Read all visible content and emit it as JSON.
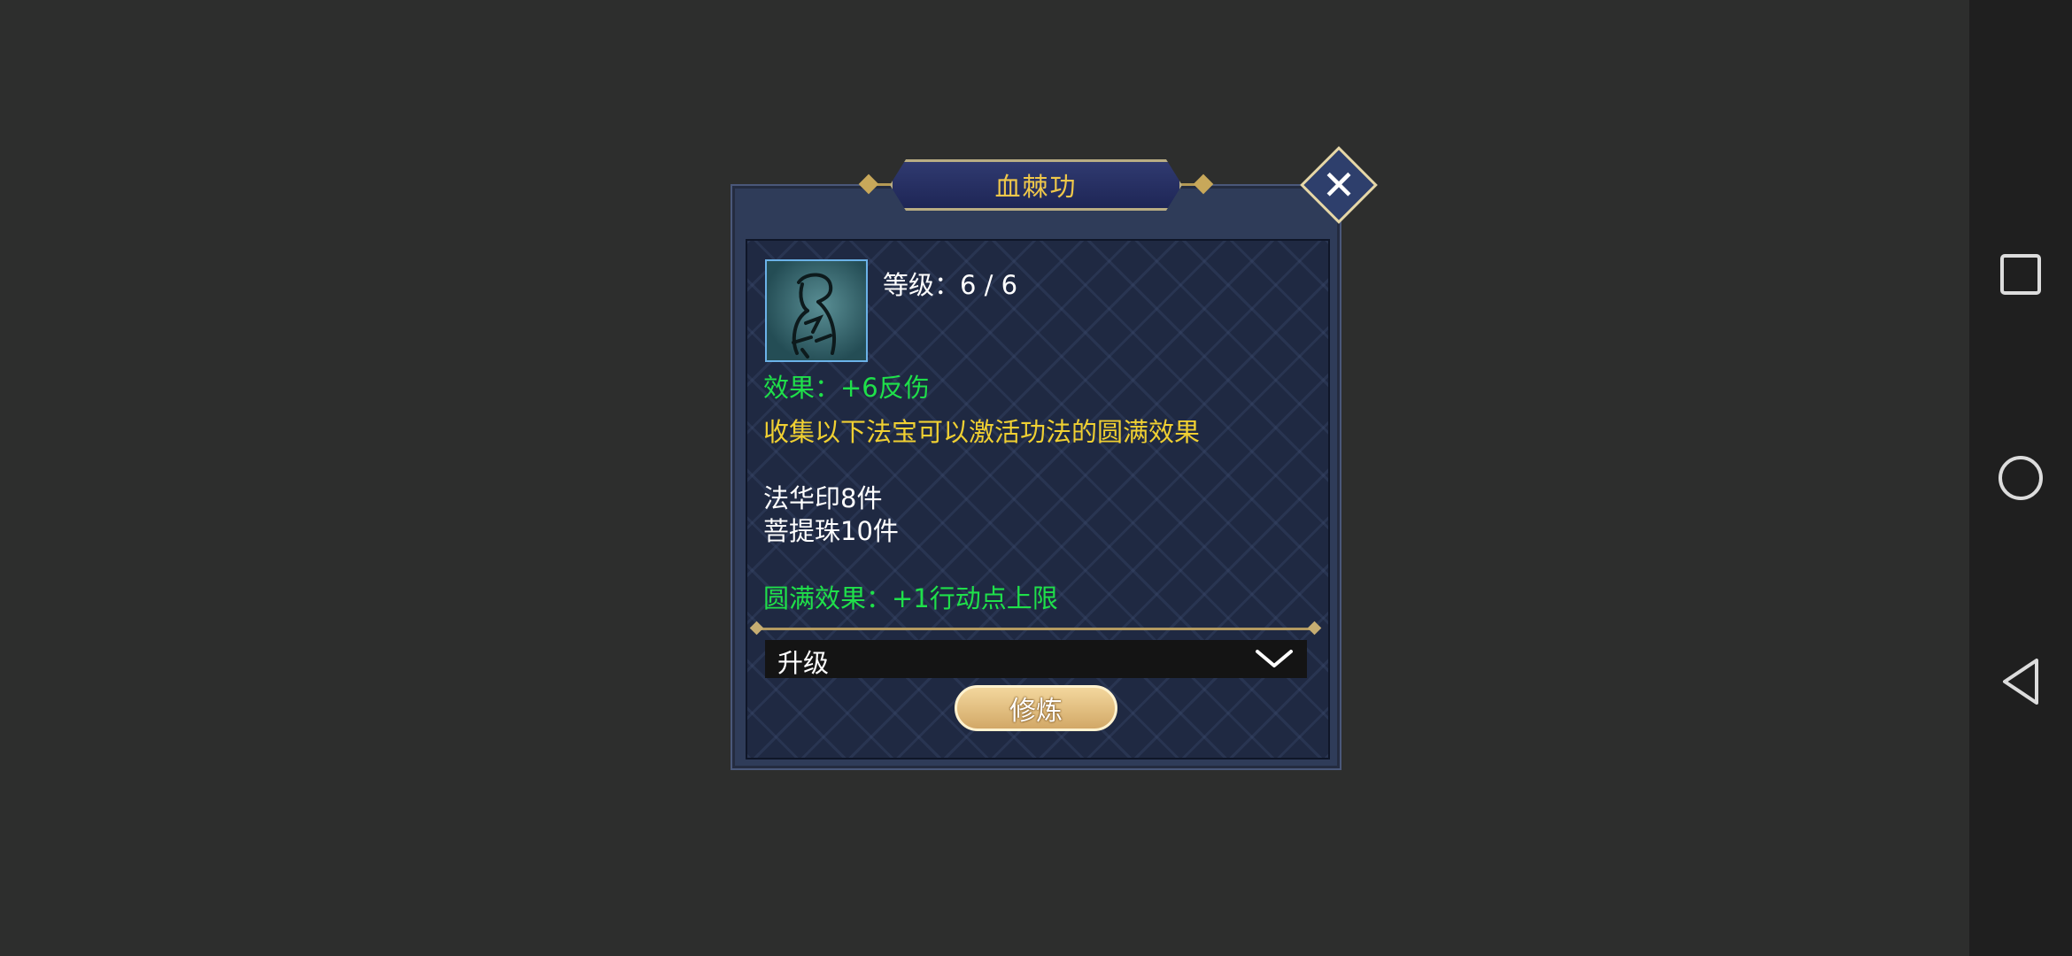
{
  "dialog": {
    "title": "血棘功",
    "level_text": "等级：6 / 6",
    "effect_text": "效果：+6反伤",
    "collect_hint": "收集以下法宝可以激活功法的圆满效果",
    "items": [
      "法华印8件",
      "菩提珠10件"
    ],
    "complete_effect": "圆满效果：+1行动点上限",
    "dropdown": {
      "selected": "升级"
    },
    "practice_button": "修炼",
    "close_icon": "close-icon"
  },
  "colors": {
    "background": "#2d2e2d",
    "title_gold": "#f0c84a",
    "effect_green": "#1fe04a",
    "hint_yellow": "#f0d032",
    "button_gold": "#d2a867"
  },
  "navbar": {
    "icons": [
      "recent-apps-icon",
      "home-icon",
      "back-icon"
    ]
  }
}
